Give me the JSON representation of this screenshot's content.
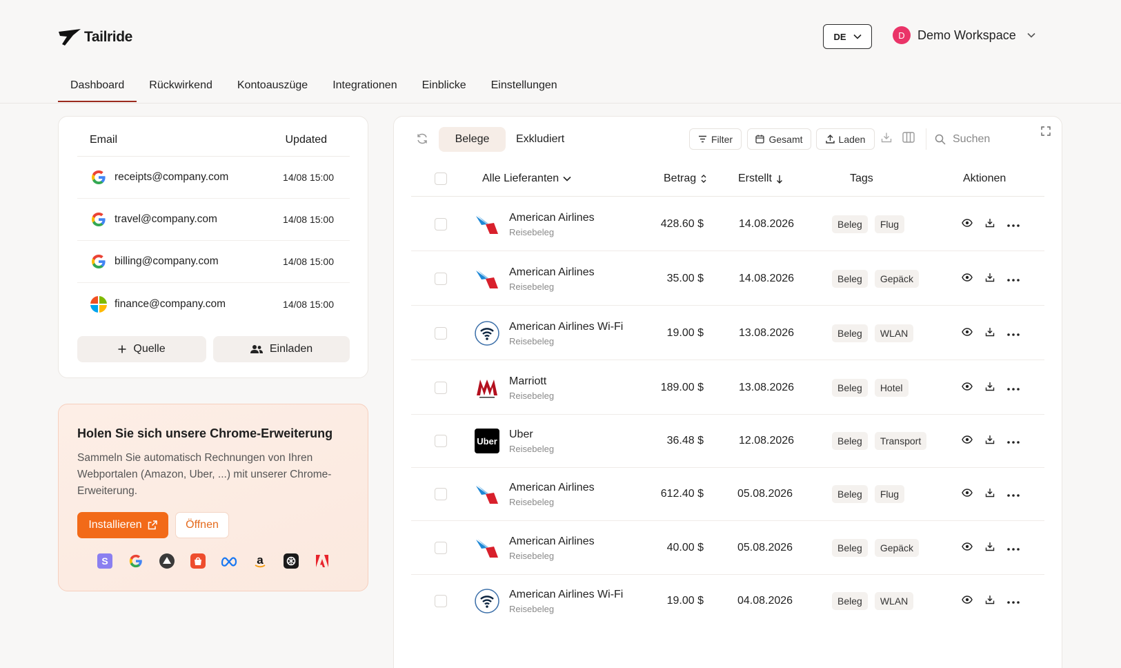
{
  "brand": {
    "name": "Tailride"
  },
  "header": {
    "language": "DE",
    "workspace_initial": "D",
    "workspace_name": "Demo Workspace"
  },
  "tabs": [
    {
      "label": "Dashboard",
      "active": true
    },
    {
      "label": "Rückwirkend"
    },
    {
      "label": "Kontoauszüge"
    },
    {
      "label": "Integrationen"
    },
    {
      "label": "Einblicke"
    },
    {
      "label": "Einstellungen"
    }
  ],
  "sources": {
    "col_email": "Email",
    "col_updated": "Updated",
    "rows": [
      {
        "provider": "google-icon",
        "email": "receipts@company.com",
        "updated": "14/08 15:00"
      },
      {
        "provider": "google-icon",
        "email": "travel@company.com",
        "updated": "14/08 15:00"
      },
      {
        "provider": "google-icon",
        "email": "billing@company.com",
        "updated": "14/08 15:00"
      },
      {
        "provider": "microsoft-icon",
        "email": "finance@company.com",
        "updated": "14/08 15:00"
      }
    ],
    "add_source_label": "Quelle",
    "invite_label": "Einladen"
  },
  "chrome_ext": {
    "title": "Holen Sie sich unsere Chrome-Erweiterung",
    "description": "Sammeln Sie automatisch Rechnungen von Ihren Webportalen (Amazon, Uber, ...) mit unserer Chrome-Erweiterung.",
    "install_label": "Installieren",
    "open_label": "Öffnen",
    "brand_icons": [
      "stripe-icon",
      "google-icon",
      "vercel-icon",
      "shopify-icon",
      "meta-icon",
      "amazon-icon",
      "openai-icon",
      "adobe-icon"
    ]
  },
  "toolbar": {
    "segment_active": "Belege",
    "segment_other": "Exkludiert",
    "filter_label": "Filter",
    "total_label": "Gesamt",
    "upload_label": "Laden",
    "search_placeholder": "Suchen"
  },
  "table": {
    "col_vendor": "Alle Lieferanten",
    "col_amount": "Betrag",
    "col_created": "Erstellt",
    "col_tags": "Tags",
    "col_actions": "Aktionen",
    "rows": [
      {
        "vendor": "American Airlines",
        "type": "Reisebeleg",
        "logo": "american-airlines-logo",
        "amount": "428.60 $",
        "date": "14.08.2026",
        "tags": [
          "Beleg",
          "Flug"
        ]
      },
      {
        "vendor": "American Airlines",
        "type": "Reisebeleg",
        "logo": "american-airlines-logo",
        "amount": "35.00 $",
        "date": "14.08.2026",
        "tags": [
          "Beleg",
          "Gepäck"
        ]
      },
      {
        "vendor": "American Airlines Wi-Fi",
        "type": "Reisebeleg",
        "logo": "wifi-logo",
        "amount": "19.00 $",
        "date": "13.08.2026",
        "tags": [
          "Beleg",
          "WLAN"
        ]
      },
      {
        "vendor": "Marriott",
        "type": "Reisebeleg",
        "logo": "marriott-logo",
        "amount": "189.00 $",
        "date": "13.08.2026",
        "tags": [
          "Beleg",
          "Hotel"
        ]
      },
      {
        "vendor": "Uber",
        "type": "Reisebeleg",
        "logo": "uber-logo",
        "amount": "36.48 $",
        "date": "12.08.2026",
        "tags": [
          "Beleg",
          "Transport"
        ]
      },
      {
        "vendor": "American Airlines",
        "type": "Reisebeleg",
        "logo": "american-airlines-logo",
        "amount": "612.40 $",
        "date": "05.08.2026",
        "tags": [
          "Beleg",
          "Flug"
        ]
      },
      {
        "vendor": "American Airlines",
        "type": "Reisebeleg",
        "logo": "american-airlines-logo",
        "amount": "40.00 $",
        "date": "05.08.2026",
        "tags": [
          "Beleg",
          "Gepäck"
        ]
      },
      {
        "vendor": "American Airlines Wi-Fi",
        "type": "Reisebeleg",
        "logo": "wifi-logo",
        "amount": "19.00 $",
        "date": "04.08.2026",
        "tags": [
          "Beleg",
          "WLAN"
        ]
      }
    ]
  },
  "colors": {
    "accent": "#f26a18",
    "tab_underline": "#9b2a1e",
    "avatar": "#ea3468"
  }
}
